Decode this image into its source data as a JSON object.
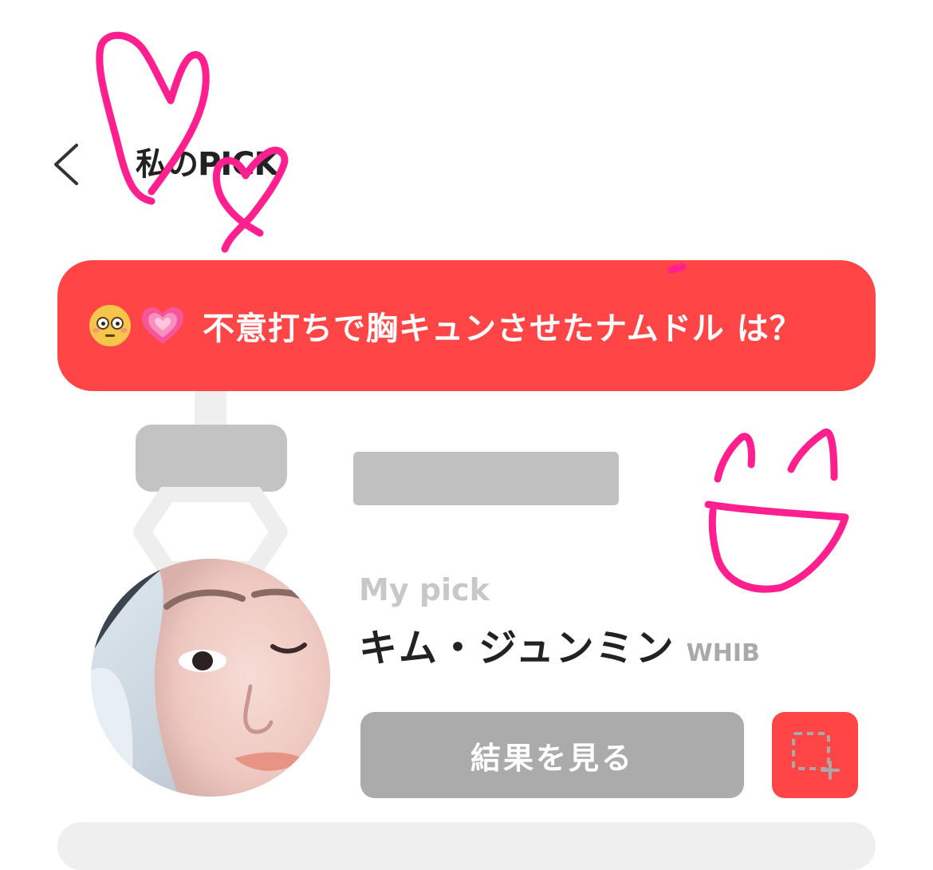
{
  "header": {
    "title": "私のPICK",
    "back_icon": "chevron-left-icon"
  },
  "question": {
    "text": "不意打ちで胸キュンさせたナムドル は？",
    "emojis": [
      "flushed-face-emoji",
      "growing-heart-emoji"
    ]
  },
  "pick": {
    "label": "My pick",
    "name": "キム・ジュンミン",
    "group": "WHIB"
  },
  "actions": {
    "results_label": "結果を見る",
    "capture_icon": "screenshot-capture-icon"
  },
  "colors": {
    "accent_red": "#ff4545",
    "button_gray": "#ababab",
    "placeholder_gray": "#c1c1c1",
    "doodle_pink": "#ff1f8e"
  }
}
